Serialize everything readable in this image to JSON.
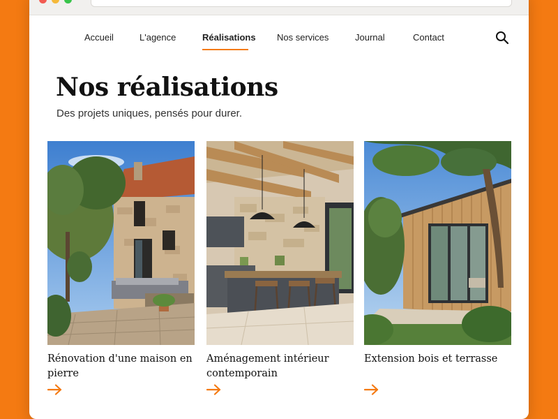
{
  "browser": {
    "url": ""
  },
  "nav": {
    "items": [
      {
        "label": "Accueil",
        "active": false
      },
      {
        "label": "L'agence",
        "active": false
      },
      {
        "label": "Réalisations",
        "active": true
      },
      {
        "label": "Nos services",
        "active": false
      },
      {
        "label": "Journal",
        "active": false
      },
      {
        "label": "Contact",
        "active": false
      }
    ],
    "search_icon": "search-icon"
  },
  "header": {
    "title": "Nos réalisations",
    "subtitle": "Des projets uniques, pensés pour durer."
  },
  "projects": [
    {
      "title": "Rénovation d'une maison en pierre",
      "image": "stone-house-terrace",
      "link_icon": "arrow-right-icon"
    },
    {
      "title": "Aménagement intérieur contemporain",
      "image": "modern-kitchen-interior",
      "link_icon": "arrow-right-icon"
    },
    {
      "title": "Extension bois et terrasse",
      "image": "wooden-extension-garden",
      "link_icon": "arrow-right-icon"
    }
  ],
  "colors": {
    "accent": "#F47A12",
    "background": "#F47A12",
    "text": "#111111"
  }
}
